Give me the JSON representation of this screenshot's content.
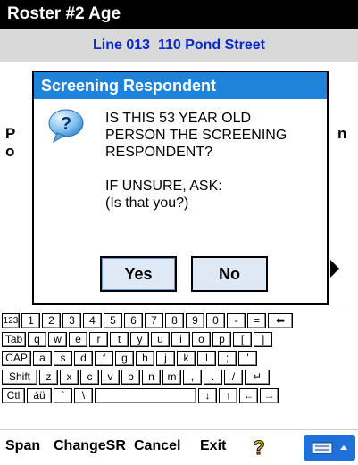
{
  "app": {
    "title": "Roster #2 Age",
    "subtitle": "Line 013  110 Pond Street"
  },
  "background": {
    "left_letters": "P\no",
    "right_letter": "n"
  },
  "dialog": {
    "title": "Screening Respondent",
    "lines": [
      "IS THIS 53 YEAR OLD",
      "PERSON THE SCREENING",
      "RESPONDENT?"
    ],
    "lines2": [
      "IF UNSURE, ASK:",
      "(Is that you?)"
    ],
    "yes_label": "Yes",
    "no_label": "No"
  },
  "keyboard": {
    "rows": [
      [
        "123",
        "1",
        "2",
        "3",
        "4",
        "5",
        "6",
        "7",
        "8",
        "9",
        "0",
        "-",
        "=",
        "⬅"
      ],
      [
        "Tab",
        "q",
        "w",
        "e",
        "r",
        "t",
        "y",
        "u",
        "i",
        "o",
        "p",
        "[",
        "]"
      ],
      [
        "CAP",
        "a",
        "s",
        "d",
        "f",
        "g",
        "h",
        "j",
        "k",
        "l",
        ";",
        "'"
      ],
      [
        "Shift",
        "z",
        "x",
        "c",
        "v",
        "b",
        "n",
        "m",
        ",",
        ".",
        "/",
        "↵"
      ],
      [
        "Ctl",
        "áü",
        "`",
        "\\",
        " ",
        "↓",
        "↑",
        "←",
        "→"
      ]
    ]
  },
  "menubar": {
    "span": "Span",
    "changesr": "ChangeSR",
    "cancel": "Cancel",
    "exit": "Exit"
  },
  "colors": {
    "title_bg": "#000000",
    "accent_blue": "#1f83d9",
    "subtitle_text": "#0a29c6",
    "button_fill": "#dfe9f6"
  }
}
